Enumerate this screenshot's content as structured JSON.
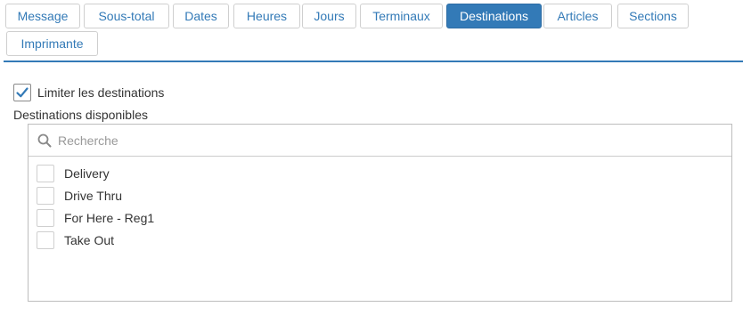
{
  "tabs": [
    {
      "label": "Message",
      "active": false
    },
    {
      "label": "Sous-total",
      "active": false
    },
    {
      "label": "Dates",
      "active": false
    },
    {
      "label": "Heures",
      "active": false
    },
    {
      "label": "Jours",
      "active": false
    },
    {
      "label": "Terminaux",
      "active": false
    },
    {
      "label": "Destinations",
      "active": true
    },
    {
      "label": "Articles",
      "active": false
    },
    {
      "label": "Sections",
      "active": false
    },
    {
      "label": "Imprimante",
      "active": false
    }
  ],
  "limit": {
    "label": "Limiter les destinations",
    "checked": true
  },
  "available": {
    "label": "Destinations disponibles",
    "search_placeholder": "Recherche",
    "items": [
      {
        "label": "Delivery",
        "checked": false
      },
      {
        "label": "Drive Thru",
        "checked": false
      },
      {
        "label": "For Here - Reg1",
        "checked": false
      },
      {
        "label": "Take Out",
        "checked": false
      }
    ]
  },
  "colors": {
    "accent": "#337ab7",
    "border": "#cfcfcf",
    "text": "#333333"
  },
  "icons": {
    "search": "search-icon",
    "check": "checkmark-icon"
  }
}
